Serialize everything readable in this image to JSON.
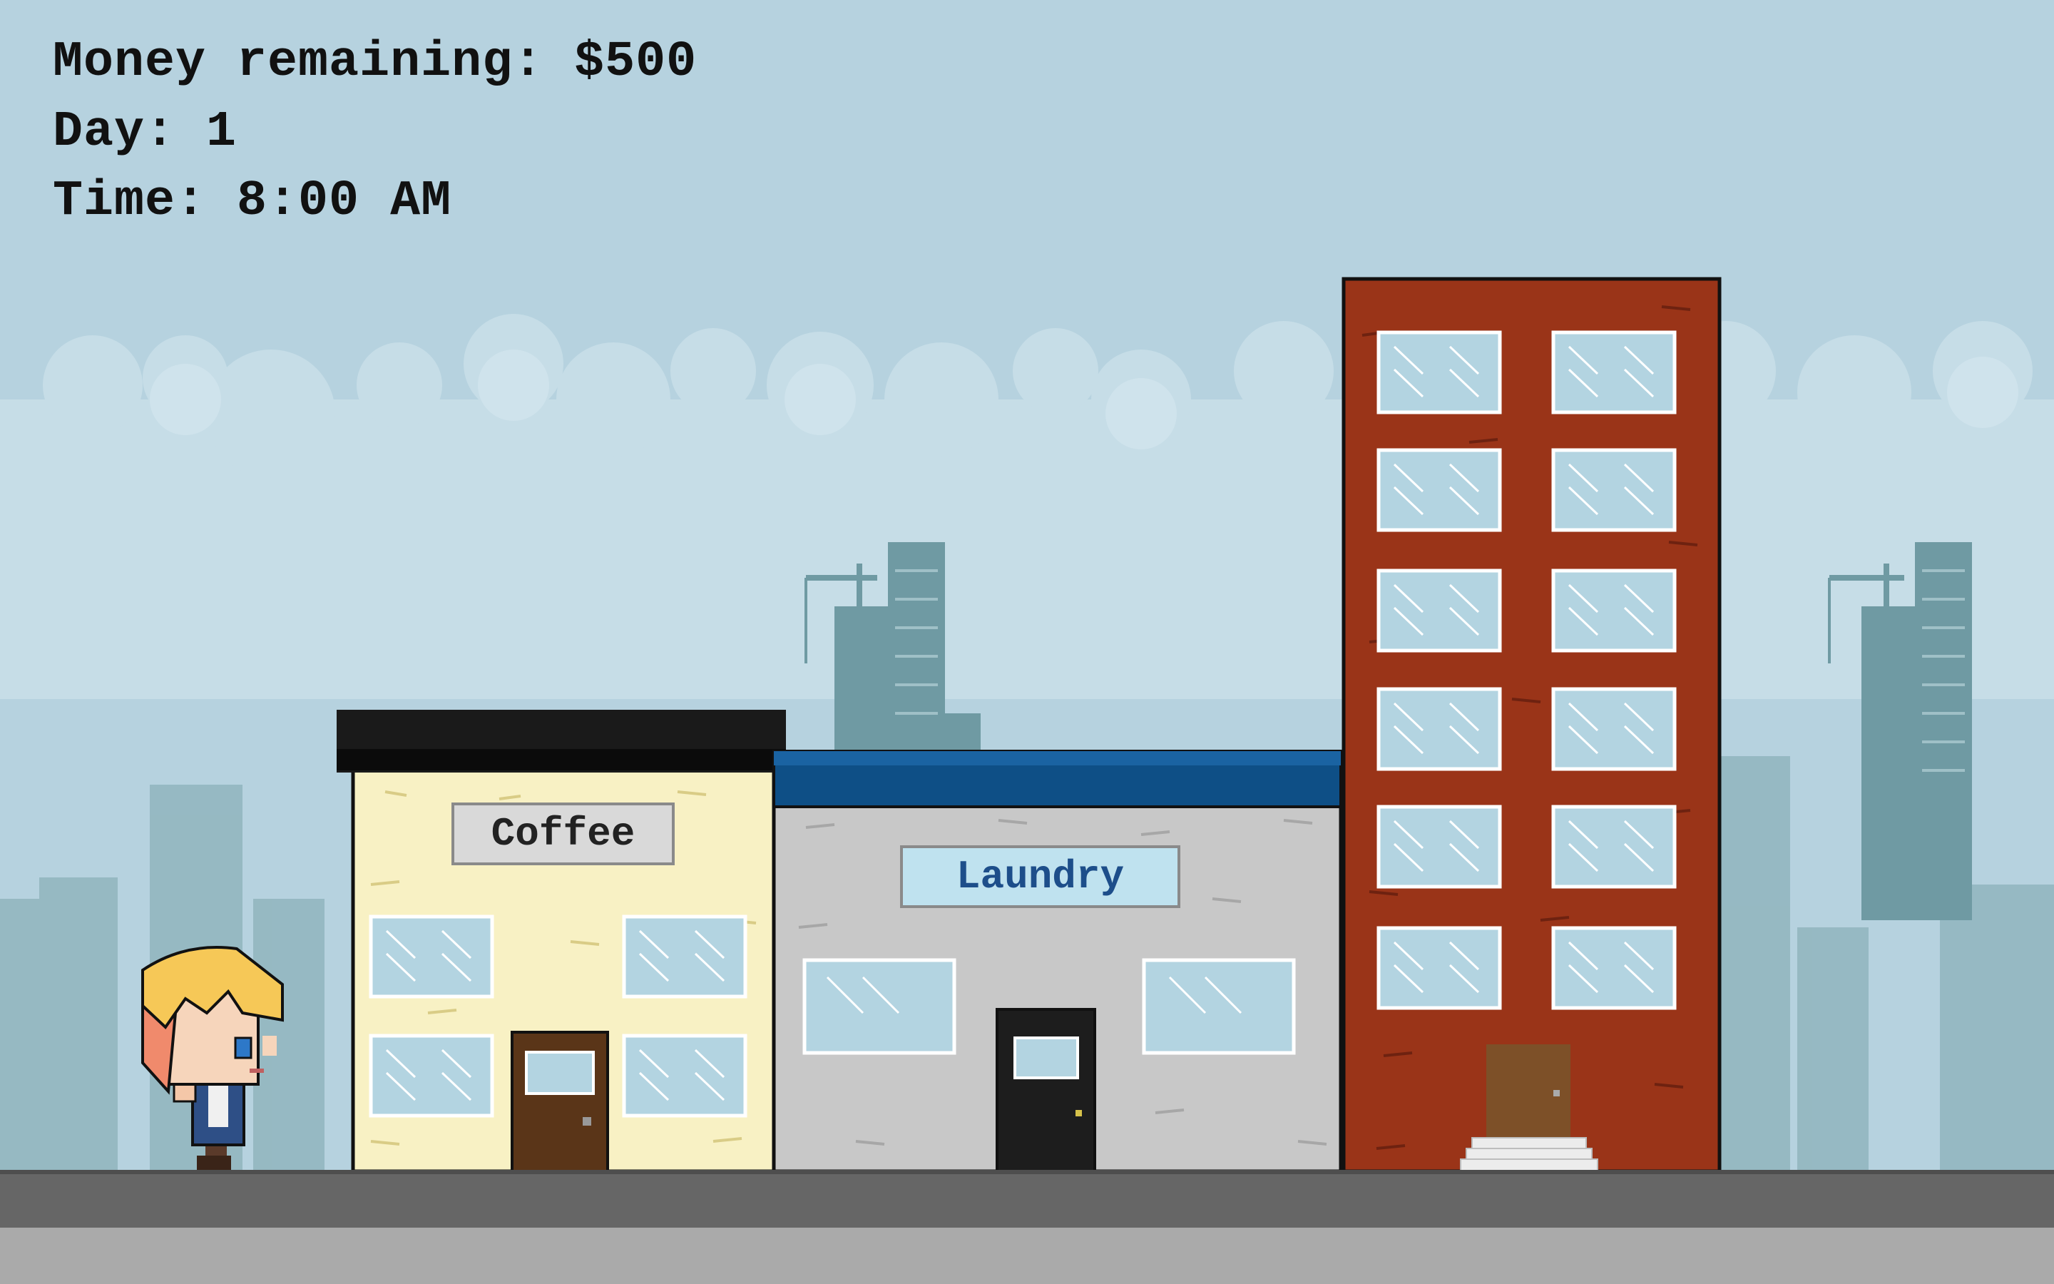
{
  "hud": {
    "money": "Money remaining: $500",
    "day": "Day: 1",
    "time": "Time: 8:00 AM"
  },
  "buildings": {
    "coffee": {
      "sign": "Coffee",
      "wall_color": "#f8f1c4",
      "roof_color": "#1a1a1a"
    },
    "laundry": {
      "sign": "Laundry",
      "wall_color": "#c8c8c8",
      "roof_color": "#0e4f86"
    },
    "apartment": {
      "wall_color": "#9a3418"
    }
  },
  "colors": {
    "sky": "#b6d2df",
    "clouds": "#c9e0ea",
    "skyline": "#6f9aa3",
    "street": "#666666",
    "sidewalk": "#aaaaaa",
    "window": "#b3d4e1"
  }
}
